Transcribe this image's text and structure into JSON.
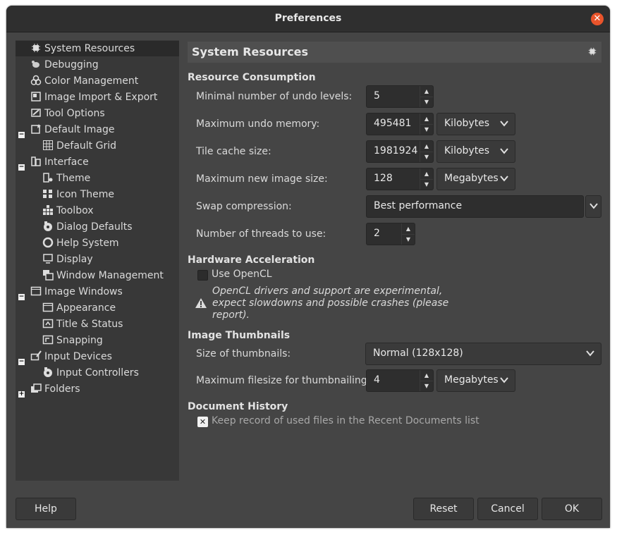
{
  "window": {
    "title": "Preferences"
  },
  "sidebar": {
    "items": [
      {
        "label": "System Resources",
        "icon": "chip-icon"
      },
      {
        "label": "Debugging",
        "icon": "bug-icon"
      },
      {
        "label": "Color Management",
        "icon": "color-circles-icon"
      },
      {
        "label": "Image Import & Export",
        "icon": "image-import-icon"
      },
      {
        "label": "Tool Options",
        "icon": "tool-options-icon"
      },
      {
        "label": "Default Image",
        "icon": "default-image-icon",
        "expanded": true
      },
      {
        "label": "Default Grid",
        "icon": "grid-icon"
      },
      {
        "label": "Interface",
        "icon": "interface-icon",
        "expanded": true
      },
      {
        "label": "Theme",
        "icon": "theme-icon"
      },
      {
        "label": "Icon Theme",
        "icon": "icon-theme-icon"
      },
      {
        "label": "Toolbox",
        "icon": "toolbox-icon"
      },
      {
        "label": "Dialog Defaults",
        "icon": "dialog-defaults-icon"
      },
      {
        "label": "Help System",
        "icon": "help-lifebuoy-icon"
      },
      {
        "label": "Display",
        "icon": "display-icon"
      },
      {
        "label": "Window Management",
        "icon": "window-management-icon"
      },
      {
        "label": "Image Windows",
        "icon": "image-windows-icon",
        "expanded": true
      },
      {
        "label": "Appearance",
        "icon": "appearance-icon"
      },
      {
        "label": "Title & Status",
        "icon": "title-status-icon"
      },
      {
        "label": "Snapping",
        "icon": "snapping-icon"
      },
      {
        "label": "Input Devices",
        "icon": "input-devices-icon",
        "expanded": true
      },
      {
        "label": "Input Controllers",
        "icon": "input-controllers-icon"
      },
      {
        "label": "Folders",
        "icon": "folders-icon",
        "expanded": false
      }
    ]
  },
  "main": {
    "header": "System Resources",
    "resource": {
      "title": "Resource Consumption",
      "undo_levels_label": "Minimal number of undo levels:",
      "undo_levels_value": "5",
      "undo_memory_label": "Maximum undo memory:",
      "undo_memory_value": "495481",
      "undo_memory_unit": "Kilobytes",
      "tile_cache_label": "Tile cache size:",
      "tile_cache_value": "1981924",
      "tile_cache_unit": "Kilobytes",
      "max_image_label": "Maximum new image size:",
      "max_image_value": "128",
      "max_image_unit": "Megabytes",
      "swap_label": "Swap compression:",
      "swap_value": "Best performance",
      "threads_label": "Number of threads to use:",
      "threads_value": "2"
    },
    "hardware": {
      "title": "Hardware Acceleration",
      "opencl_label": "Use OpenCL",
      "opencl_checked": false,
      "note_line1": "OpenCL drivers and support are experimental,",
      "note_line2": "expect slowdowns and possible crashes (please",
      "note_line3": "report)."
    },
    "thumbnails": {
      "title": "Image Thumbnails",
      "size_label": "Size of thumbnails:",
      "size_value": "Normal (128x128)",
      "filesize_label": "Maximum filesize for thumbnailing:",
      "filesize_value": "4",
      "filesize_unit": "Megabytes"
    },
    "history": {
      "title": "Document History",
      "keep_label": "Keep record of used files in the Recent Documents list",
      "keep_checked": true
    }
  },
  "buttons": {
    "help": "Help",
    "reset": "Reset",
    "cancel": "Cancel",
    "ok": "OK"
  },
  "colors": {
    "close": "#e9542b",
    "background": "#454545",
    "sidebar": "#383838"
  }
}
